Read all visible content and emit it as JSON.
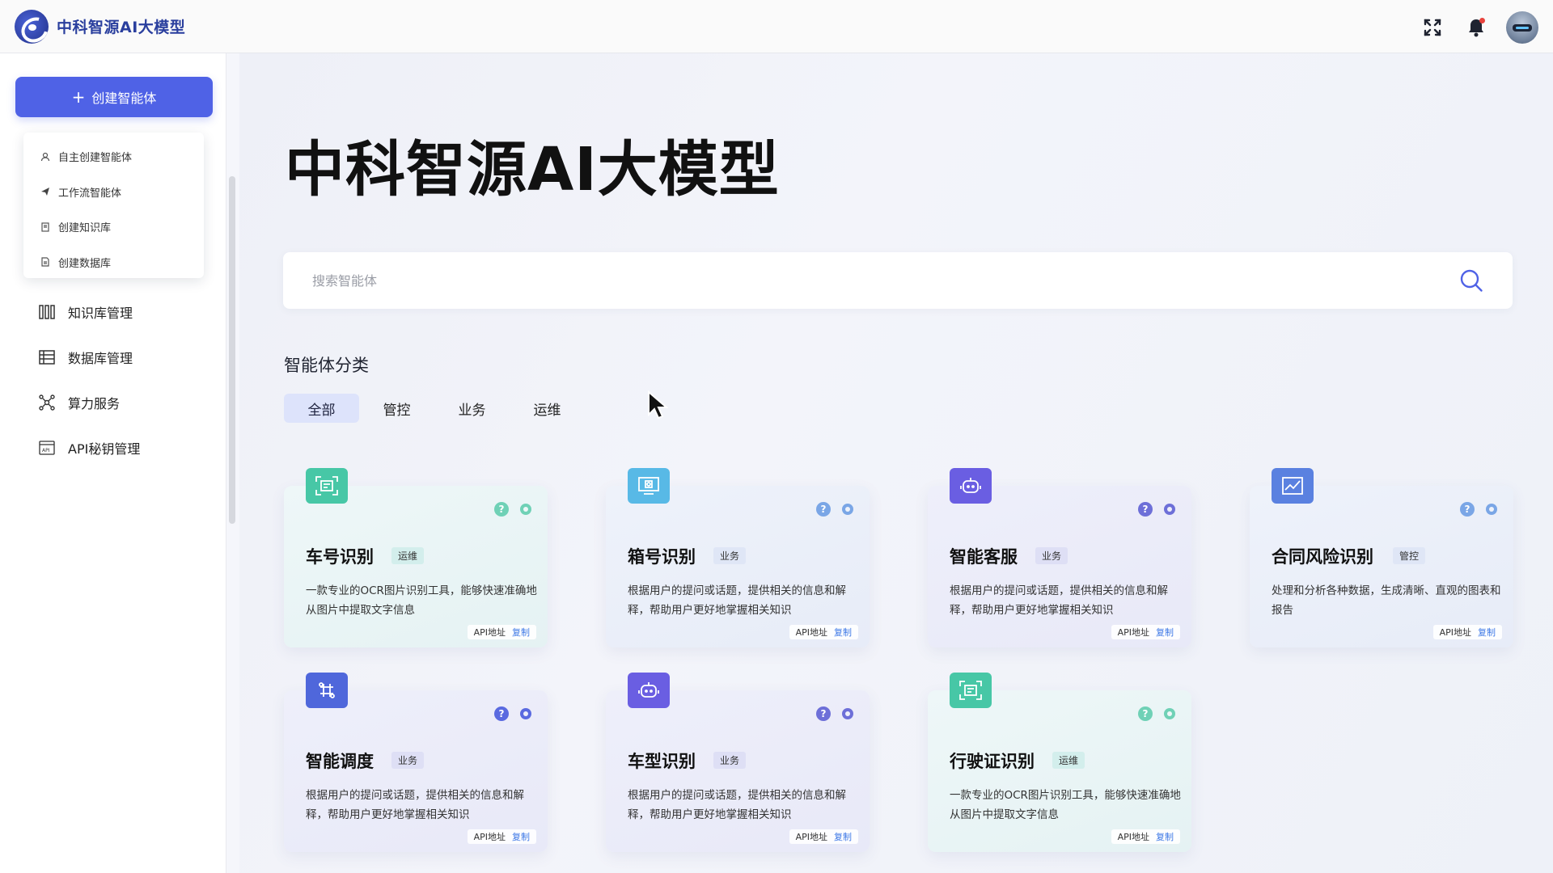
{
  "topbar": {
    "brand_name": "中科智源AI大模型"
  },
  "sidebar": {
    "create_button_label": "创建智能体",
    "dropdown": [
      {
        "label": "自主创建智能体",
        "icon": "user-icon"
      },
      {
        "label": "工作流智能体",
        "icon": "paper-plane-icon"
      },
      {
        "label": "创建知识库",
        "icon": "book-icon"
      },
      {
        "label": "创建数据库",
        "icon": "document-icon"
      }
    ],
    "nav": [
      {
        "label": "知识库管理",
        "icon": "books-icon"
      },
      {
        "label": "数据库管理",
        "icon": "table-icon"
      },
      {
        "label": "算力服务",
        "icon": "network-icon"
      },
      {
        "label": "API秘钥管理",
        "icon": "api-icon"
      }
    ]
  },
  "main": {
    "hero_title": "中科智源AI大模型",
    "search_placeholder": "搜索智能体",
    "section_title": "智能体分类",
    "tabs": [
      "全部",
      "管控",
      "业务",
      "运维"
    ],
    "active_tab": "全部"
  },
  "cards": [
    {
      "title": "车号识别",
      "tag": "运维",
      "desc": "一款专业的OCR图片识别工具，能够快速准确地从图片中提取文字信息",
      "api_label": "API地址",
      "copy_label": "复制",
      "icon": "ocr-scan-icon"
    },
    {
      "title": "箱号识别",
      "tag": "业务",
      "desc": "根据用户的提问或话题，提供相关的信息和解释，帮助用户更好地掌握相关知识",
      "api_label": "API地址",
      "copy_label": "复制",
      "icon": "screen-icon"
    },
    {
      "title": "智能客服",
      "tag": "业务",
      "desc": "根据用户的提问或话题，提供相关的信息和解释，帮助用户更好地掌握相关知识",
      "api_label": "API地址",
      "copy_label": "复制",
      "icon": "robot-icon"
    },
    {
      "title": "合同风险识别",
      "tag": "管控",
      "desc": "处理和分析各种数据，生成清晰、直观的图表和报告",
      "api_label": "API地址",
      "copy_label": "复制",
      "icon": "chart-icon"
    },
    {
      "title": "智能调度",
      "tag": "业务",
      "desc": "根据用户的提问或话题，提供相关的信息和解释，帮助用户更好地掌握相关知识",
      "api_label": "API地址",
      "copy_label": "复制",
      "icon": "command-icon"
    },
    {
      "title": "车型识别",
      "tag": "业务",
      "desc": "根据用户的提问或话题，提供相关的信息和解释，帮助用户更好地掌握相关知识",
      "api_label": "API地址",
      "copy_label": "复制",
      "icon": "robot-icon"
    },
    {
      "title": "行驶证识别",
      "tag": "运维",
      "desc": "一款专业的OCR图片识别工具，能够快速准确地从图片中提取文字信息",
      "api_label": "API地址",
      "copy_label": "复制",
      "icon": "ocr-scan-icon"
    }
  ],
  "colors": {
    "accent": "#4f62e6",
    "brand": "#2a3f9e",
    "teal": "#47c7a6",
    "link": "#3d78e6"
  }
}
